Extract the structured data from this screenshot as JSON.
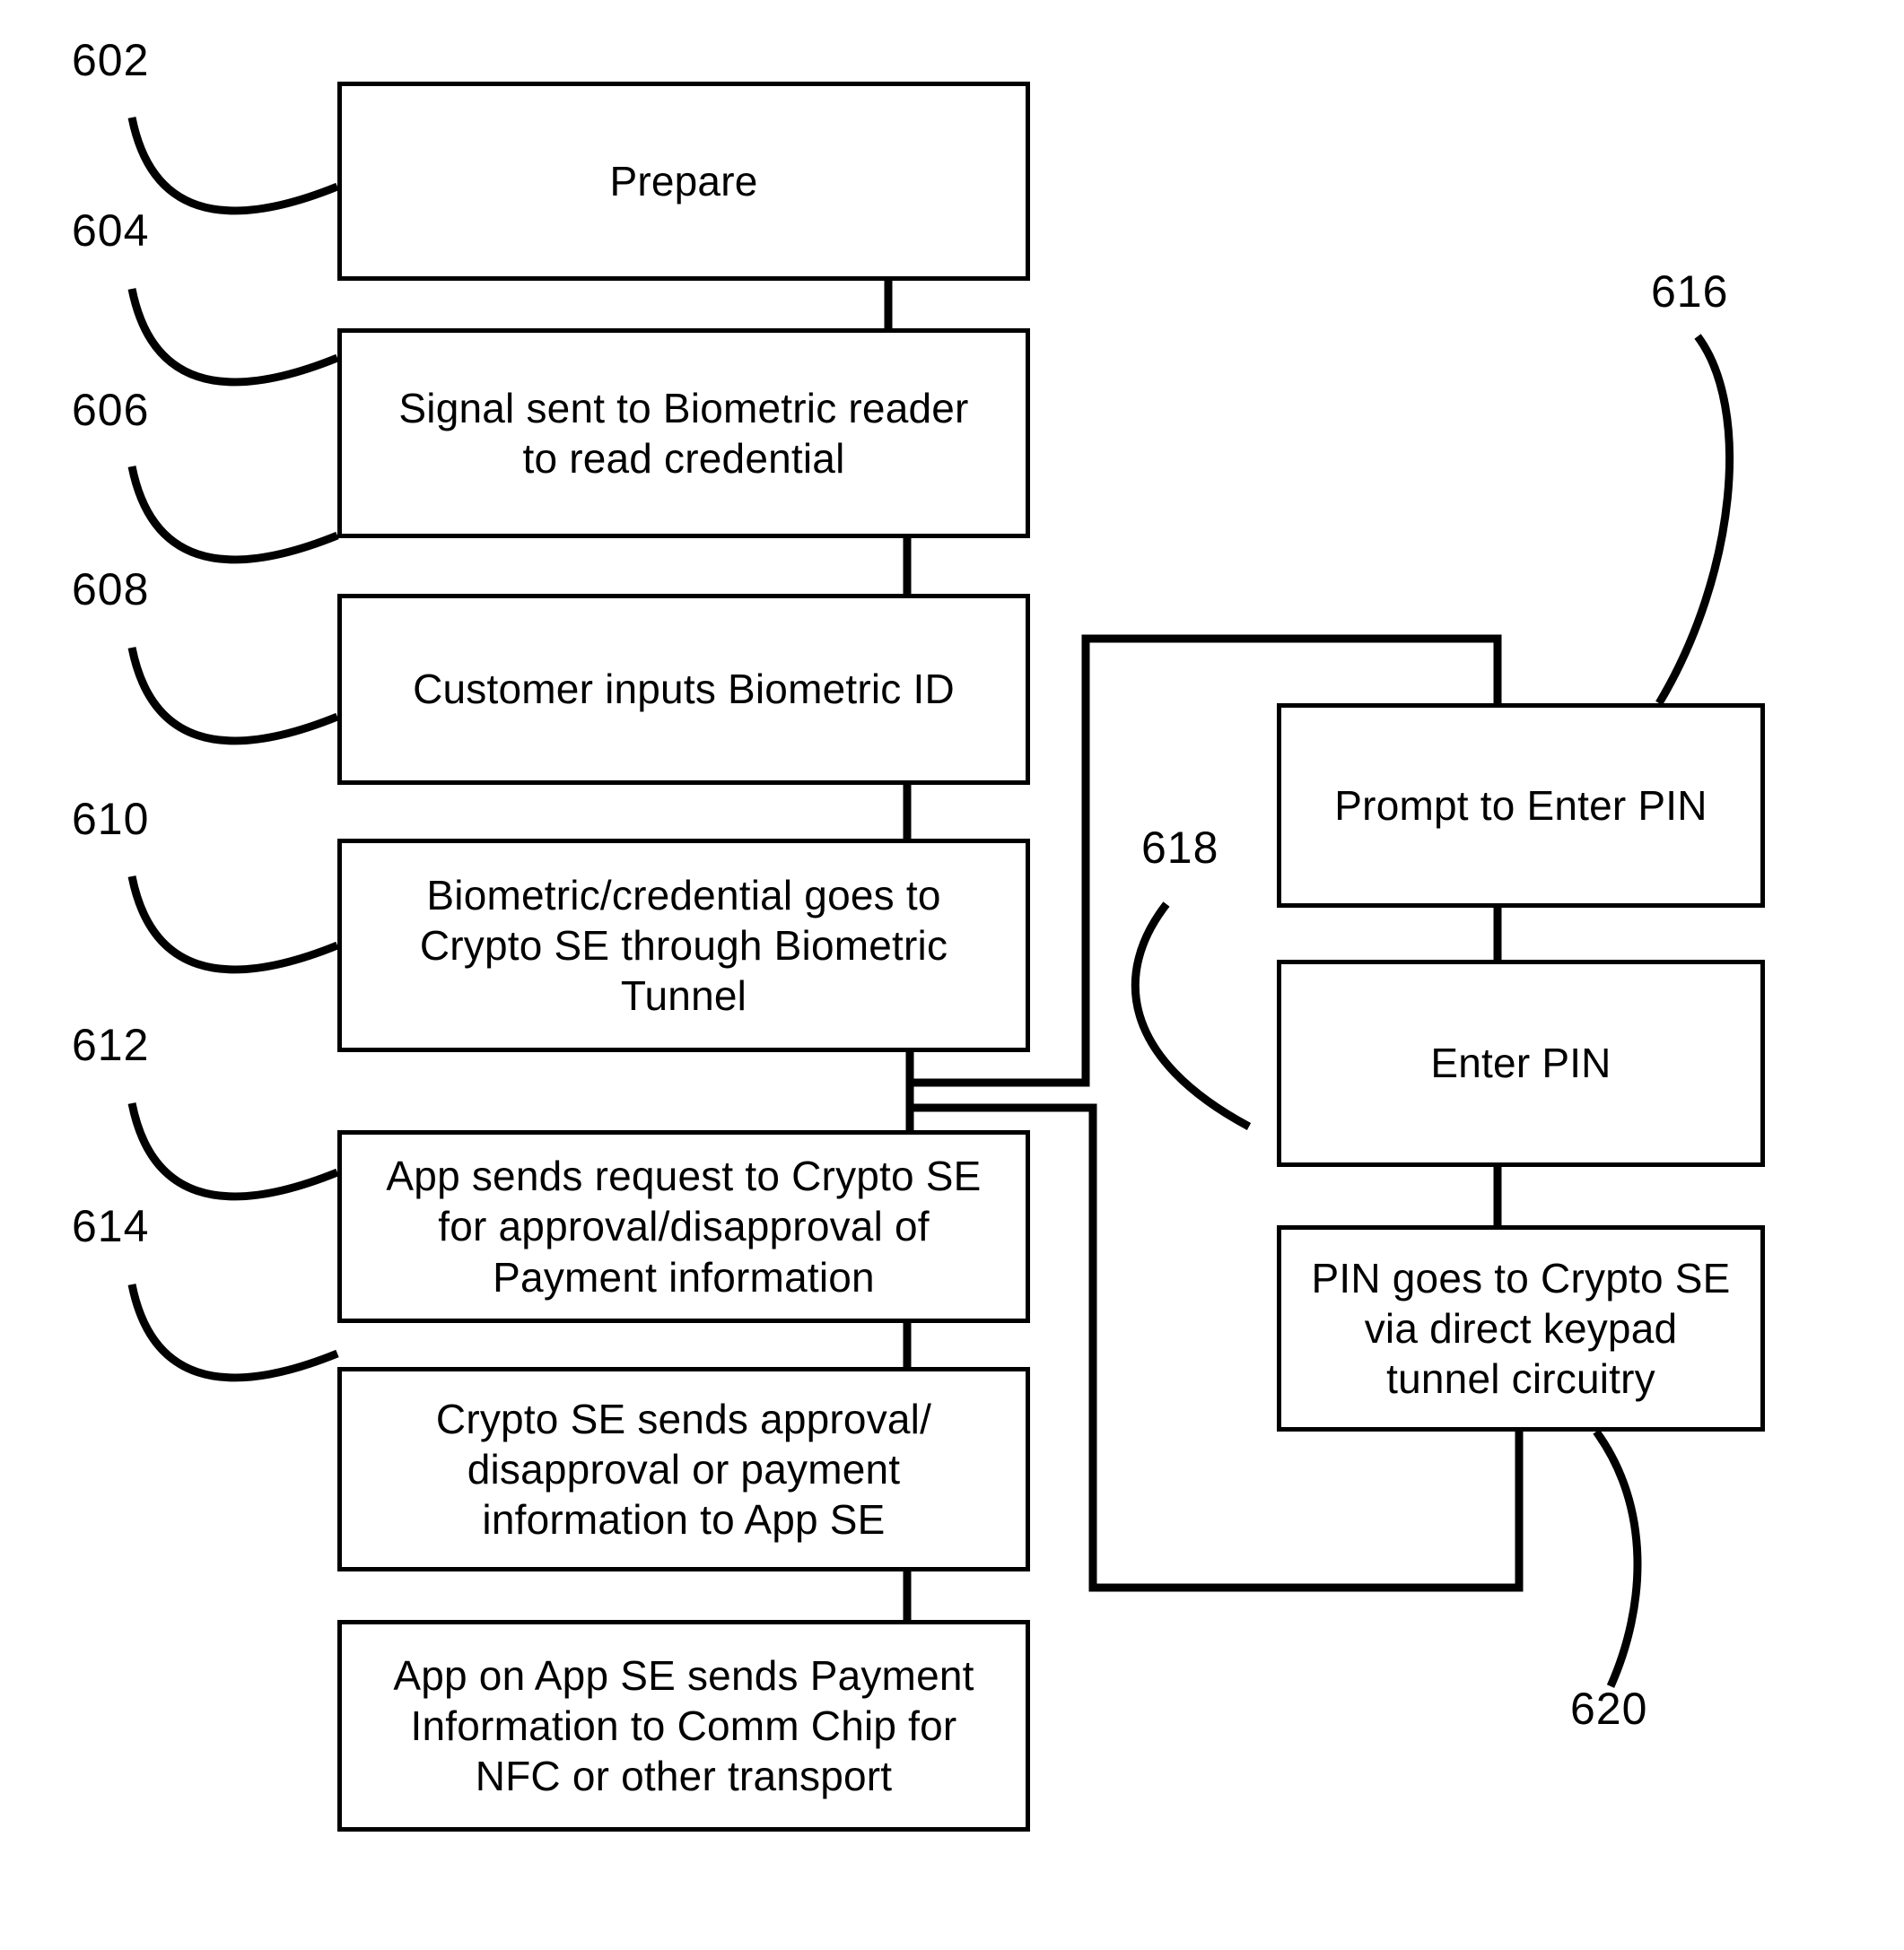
{
  "figure": {
    "kind": "patent-flowchart",
    "stroke_color": "#000000",
    "background_color": "#ffffff"
  },
  "boxes": {
    "prepare": {
      "text": "Prepare"
    },
    "signal_biometric_reader": {
      "text": "Signal sent to Biometric reader\nto read credential"
    },
    "customer_inputs_biometric": {
      "text": "Customer inputs Biometric ID"
    },
    "biometric_to_crypto_se": {
      "text": "Biometric/credential goes to\nCrypto SE through Biometric\nTunnel"
    },
    "app_sends_request": {
      "text": "App sends request to Crypto SE\nfor approval/disapproval of\nPayment information"
    },
    "crypto_se_sends_approval": {
      "text": "Crypto SE sends approval/\ndisapproval or payment\ninformation to App SE"
    },
    "app_sends_payment_info": {
      "text": "App on App SE sends Payment\nInformation to Comm Chip for\nNFC or other transport"
    },
    "prompt_enter_pin": {
      "text": "Prompt to Enter PIN"
    },
    "enter_pin": {
      "text": "Enter PIN"
    },
    "pin_to_crypto_se": {
      "text": "PIN goes to Crypto SE\nvia direct keypad\ntunnel circuitry"
    }
  },
  "reference_numerals": {
    "n602": "602",
    "n604": "604",
    "n606": "606",
    "n608": "608",
    "n610": "610",
    "n612": "612",
    "n614": "614",
    "n616": "616",
    "n618": "618",
    "n620": "620"
  }
}
